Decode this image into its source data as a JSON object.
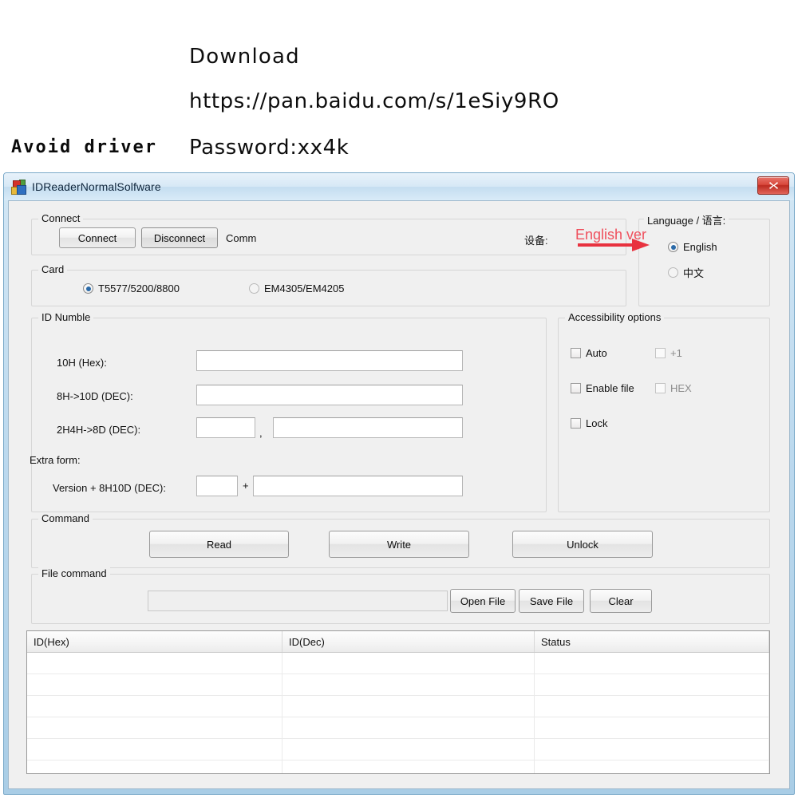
{
  "annotations": {
    "download_label": "Download",
    "url": "https://pan.baidu.com/s/1eSiy9RO",
    "password": "Password:xx4k",
    "avoid_driver": "Avoid driver",
    "english_ver": "English ver",
    "accent_red": "#ef4f5c"
  },
  "window": {
    "title": "IDReaderNormalSolfware",
    "close_tooltip": "Close"
  },
  "connect_group": {
    "legend": "Connect",
    "connect_button": "Connect",
    "disconnect_button": "Disconnect",
    "comm_label": "Comm",
    "device_label": "设备:"
  },
  "card_group": {
    "legend": "Card",
    "options": [
      {
        "label": "T5577/5200/8800",
        "selected": true
      },
      {
        "label": "EM4305/EM4205",
        "selected": false
      }
    ]
  },
  "language_group": {
    "legend": "Language / 语言:",
    "options": [
      {
        "label": "English",
        "selected": true
      },
      {
        "label": "中文",
        "selected": false
      }
    ]
  },
  "id_group": {
    "legend": "ID Numble",
    "rows": [
      {
        "label": "10H (Hex):",
        "value": ""
      },
      {
        "label": "8H->10D (DEC):",
        "value": ""
      },
      {
        "label": "2H4H->8D (DEC):",
        "value_a": "",
        "separator": ",",
        "value_b": ""
      }
    ],
    "extra_form_label": "Extra form:",
    "extra_row": {
      "label": "Version + 8H10D (DEC):",
      "value_a": "",
      "separator": "+",
      "value_b": ""
    }
  },
  "accessibility_group": {
    "legend": "Accessibility options",
    "checkboxes": [
      {
        "label": "Auto",
        "checked": false,
        "enabled": true
      },
      {
        "label": "+1",
        "checked": false,
        "enabled": false
      },
      {
        "label": "Enable file",
        "checked": false,
        "enabled": true
      },
      {
        "label": "HEX",
        "checked": false,
        "enabled": false
      },
      {
        "label": "Lock",
        "checked": false,
        "enabled": true
      }
    ]
  },
  "command_group": {
    "legend": "Command",
    "buttons": [
      "Read",
      "Write",
      "Unlock"
    ]
  },
  "file_command_group": {
    "legend": "File command",
    "path_value": "",
    "path_placeholder": "",
    "buttons": [
      "Open File",
      "Save File",
      "Clear"
    ]
  },
  "grid": {
    "columns": [
      "ID(Hex)",
      "ID(Dec)",
      "Status"
    ],
    "rows": [],
    "empty_row_count": 7
  }
}
